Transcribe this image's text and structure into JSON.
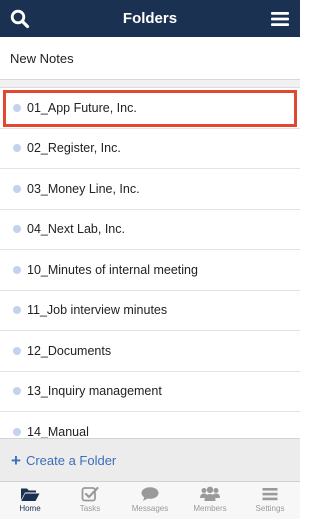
{
  "header": {
    "title": "Folders"
  },
  "new_notes": {
    "label": "New Notes"
  },
  "folders": [
    {
      "name": "01_App Future, Inc."
    },
    {
      "name": "02_Register, Inc."
    },
    {
      "name": "03_Money Line, Inc."
    },
    {
      "name": "04_Next Lab, Inc."
    },
    {
      "name": "10_Minutes of internal meeting"
    },
    {
      "name": "11_Job interview minutes"
    },
    {
      "name": "12_Documents"
    },
    {
      "name": "13_Inquiry management"
    },
    {
      "name": "14_Manual"
    }
  ],
  "create_folder": {
    "label": "Create a Folder",
    "icon": "plus-icon"
  },
  "tabs": [
    {
      "label": "Home",
      "icon": "folder-open-icon",
      "active": true
    },
    {
      "label": "Tasks",
      "icon": "checkbox-icon",
      "active": false
    },
    {
      "label": "Messages",
      "icon": "chat-bubble-icon",
      "active": false
    },
    {
      "label": "Members",
      "icon": "people-icon",
      "active": false
    },
    {
      "label": "Settings",
      "icon": "settings-bars-icon",
      "active": false
    }
  ],
  "colors": {
    "header_bg": "#1b3151",
    "accent_link": "#3b6fb9",
    "highlight_border": "#e0492f",
    "bullet": "#c3d2ee"
  }
}
